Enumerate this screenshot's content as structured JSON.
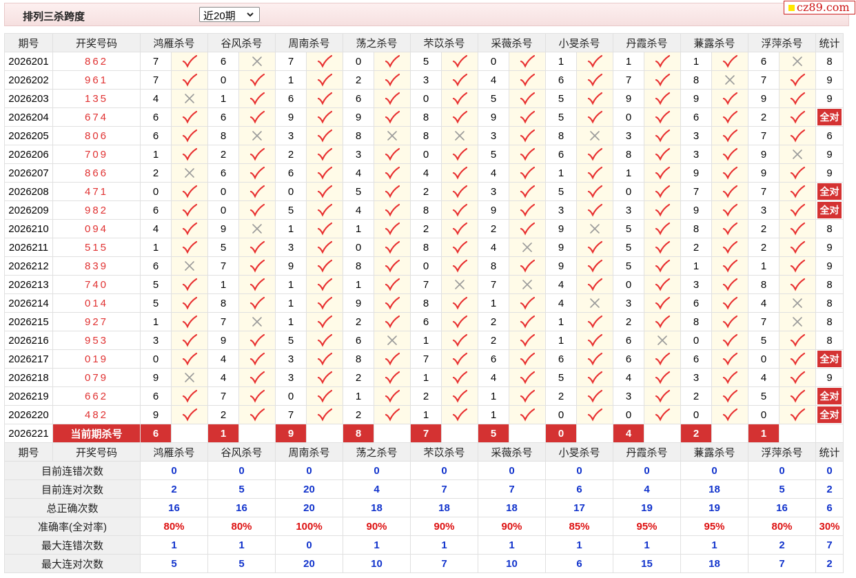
{
  "header": {
    "title": "排列三杀跨度",
    "range_select": "近20期",
    "logo_text": "cz89.com"
  },
  "columns": {
    "period": "期号",
    "draw": "开奖号码",
    "experts": [
      "鸿雁杀号",
      "谷风杀号",
      "周南杀号",
      "荡之杀号",
      "芣苡杀号",
      "采薇杀号",
      "小旻杀号",
      "丹霞杀号",
      "蒹露杀号",
      "浮萍杀号"
    ],
    "stat": "统计"
  },
  "rows": [
    {
      "period": "2026201",
      "draw": "862",
      "picks": [
        "7",
        "6",
        "7",
        "0",
        "5",
        "0",
        "1",
        "1",
        "1",
        "6"
      ],
      "hits": [
        1,
        0,
        1,
        1,
        1,
        1,
        1,
        1,
        1,
        0
      ],
      "stat": "8"
    },
    {
      "period": "2026202",
      "draw": "961",
      "picks": [
        "7",
        "0",
        "1",
        "2",
        "3",
        "4",
        "6",
        "7",
        "8",
        "7"
      ],
      "hits": [
        1,
        1,
        1,
        1,
        1,
        1,
        1,
        1,
        0,
        1
      ],
      "stat": "9"
    },
    {
      "period": "2026203",
      "draw": "135",
      "picks": [
        "4",
        "1",
        "6",
        "6",
        "0",
        "5",
        "5",
        "9",
        "9",
        "9"
      ],
      "hits": [
        0,
        1,
        1,
        1,
        1,
        1,
        1,
        1,
        1,
        1
      ],
      "stat": "9"
    },
    {
      "period": "2026204",
      "draw": "674",
      "picks": [
        "6",
        "6",
        "9",
        "9",
        "8",
        "9",
        "5",
        "0",
        "6",
        "2"
      ],
      "hits": [
        1,
        1,
        1,
        1,
        1,
        1,
        1,
        1,
        1,
        1
      ],
      "stat": "全对"
    },
    {
      "period": "2026205",
      "draw": "806",
      "picks": [
        "6",
        "8",
        "3",
        "8",
        "8",
        "3",
        "8",
        "3",
        "3",
        "7"
      ],
      "hits": [
        1,
        0,
        1,
        0,
        0,
        1,
        0,
        1,
        1,
        1
      ],
      "stat": "6"
    },
    {
      "period": "2026206",
      "draw": "709",
      "picks": [
        "1",
        "2",
        "2",
        "3",
        "0",
        "5",
        "6",
        "8",
        "3",
        "9"
      ],
      "hits": [
        1,
        1,
        1,
        1,
        1,
        1,
        1,
        1,
        1,
        0
      ],
      "stat": "9"
    },
    {
      "period": "2026207",
      "draw": "866",
      "picks": [
        "2",
        "6",
        "6",
        "4",
        "4",
        "4",
        "1",
        "1",
        "9",
        "9"
      ],
      "hits": [
        0,
        1,
        1,
        1,
        1,
        1,
        1,
        1,
        1,
        1
      ],
      "stat": "9"
    },
    {
      "period": "2026208",
      "draw": "471",
      "picks": [
        "0",
        "0",
        "0",
        "5",
        "2",
        "3",
        "5",
        "0",
        "7",
        "7"
      ],
      "hits": [
        1,
        1,
        1,
        1,
        1,
        1,
        1,
        1,
        1,
        1
      ],
      "stat": "全对"
    },
    {
      "period": "2026209",
      "draw": "982",
      "picks": [
        "6",
        "0",
        "5",
        "4",
        "8",
        "9",
        "3",
        "3",
        "9",
        "3"
      ],
      "hits": [
        1,
        1,
        1,
        1,
        1,
        1,
        1,
        1,
        1,
        1
      ],
      "stat": "全对"
    },
    {
      "period": "2026210",
      "draw": "094",
      "picks": [
        "4",
        "9",
        "1",
        "1",
        "2",
        "2",
        "9",
        "5",
        "8",
        "2"
      ],
      "hits": [
        1,
        0,
        1,
        1,
        1,
        1,
        0,
        1,
        1,
        1
      ],
      "stat": "8"
    },
    {
      "period": "2026211",
      "draw": "515",
      "picks": [
        "1",
        "5",
        "3",
        "0",
        "8",
        "4",
        "9",
        "5",
        "2",
        "2"
      ],
      "hits": [
        1,
        1,
        1,
        1,
        1,
        0,
        1,
        1,
        1,
        1
      ],
      "stat": "9"
    },
    {
      "period": "2026212",
      "draw": "839",
      "picks": [
        "6",
        "7",
        "9",
        "8",
        "0",
        "8",
        "9",
        "5",
        "1",
        "1"
      ],
      "hits": [
        0,
        1,
        1,
        1,
        1,
        1,
        1,
        1,
        1,
        1
      ],
      "stat": "9"
    },
    {
      "period": "2026213",
      "draw": "740",
      "picks": [
        "5",
        "1",
        "1",
        "1",
        "7",
        "7",
        "4",
        "0",
        "3",
        "8"
      ],
      "hits": [
        1,
        1,
        1,
        1,
        0,
        0,
        1,
        1,
        1,
        1
      ],
      "stat": "8"
    },
    {
      "period": "2026214",
      "draw": "014",
      "picks": [
        "5",
        "8",
        "1",
        "9",
        "8",
        "1",
        "4",
        "3",
        "6",
        "4"
      ],
      "hits": [
        1,
        1,
        1,
        1,
        1,
        1,
        0,
        1,
        1,
        0
      ],
      "stat": "8"
    },
    {
      "period": "2026215",
      "draw": "927",
      "picks": [
        "1",
        "7",
        "1",
        "2",
        "6",
        "2",
        "1",
        "2",
        "8",
        "7"
      ],
      "hits": [
        1,
        0,
        1,
        1,
        1,
        1,
        1,
        1,
        1,
        0
      ],
      "stat": "8"
    },
    {
      "period": "2026216",
      "draw": "953",
      "picks": [
        "3",
        "9",
        "5",
        "6",
        "1",
        "2",
        "1",
        "6",
        "0",
        "5"
      ],
      "hits": [
        1,
        1,
        1,
        0,
        1,
        1,
        1,
        0,
        1,
        1
      ],
      "stat": "8"
    },
    {
      "period": "2026217",
      "draw": "019",
      "picks": [
        "0",
        "4",
        "3",
        "8",
        "7",
        "6",
        "6",
        "6",
        "6",
        "0"
      ],
      "hits": [
        1,
        1,
        1,
        1,
        1,
        1,
        1,
        1,
        1,
        1
      ],
      "stat": "全对"
    },
    {
      "period": "2026218",
      "draw": "079",
      "picks": [
        "9",
        "4",
        "3",
        "2",
        "1",
        "4",
        "5",
        "4",
        "3",
        "4"
      ],
      "hits": [
        0,
        1,
        1,
        1,
        1,
        1,
        1,
        1,
        1,
        1
      ],
      "stat": "9"
    },
    {
      "period": "2026219",
      "draw": "662",
      "picks": [
        "6",
        "7",
        "0",
        "1",
        "2",
        "1",
        "2",
        "3",
        "2",
        "5"
      ],
      "hits": [
        1,
        1,
        1,
        1,
        1,
        1,
        1,
        1,
        1,
        1
      ],
      "stat": "全对"
    },
    {
      "period": "2026220",
      "draw": "482",
      "picks": [
        "9",
        "2",
        "7",
        "2",
        "1",
        "1",
        "0",
        "0",
        "0",
        "0"
      ],
      "hits": [
        1,
        1,
        1,
        1,
        1,
        1,
        1,
        1,
        1,
        1
      ],
      "stat": "全对"
    }
  ],
  "current": {
    "period": "2026221",
    "label": "当前期杀号",
    "picks": [
      "6",
      "1",
      "9",
      "8",
      "7",
      "5",
      "0",
      "4",
      "2",
      "1"
    ]
  },
  "summary": [
    {
      "label": "目前连错次数",
      "values": [
        "0",
        "0",
        "0",
        "0",
        "0",
        "0",
        "0",
        "0",
        "0",
        "0"
      ],
      "stat": "0",
      "color": "blue"
    },
    {
      "label": "目前连对次数",
      "values": [
        "2",
        "5",
        "20",
        "4",
        "7",
        "7",
        "6",
        "4",
        "18",
        "5"
      ],
      "stat": "2",
      "color": "blue"
    },
    {
      "label": "总正确次数",
      "values": [
        "16",
        "16",
        "20",
        "18",
        "18",
        "18",
        "17",
        "19",
        "19",
        "16"
      ],
      "stat": "6",
      "color": "blue"
    },
    {
      "label": "准确率(全对率)",
      "values": [
        "80%",
        "80%",
        "100%",
        "90%",
        "90%",
        "90%",
        "85%",
        "95%",
        "95%",
        "80%"
      ],
      "stat": "30%",
      "color": "red"
    },
    {
      "label": "最大连错次数",
      "values": [
        "1",
        "1",
        "0",
        "1",
        "1",
        "1",
        "1",
        "1",
        "1",
        "2"
      ],
      "stat": "7",
      "color": "blue"
    },
    {
      "label": "最大连对次数",
      "values": [
        "5",
        "5",
        "20",
        "10",
        "7",
        "10",
        "6",
        "15",
        "18",
        "7"
      ],
      "stat": "2",
      "color": "blue"
    }
  ],
  "icons": {
    "hit": "check-icon",
    "miss": "cross-icon",
    "hit_color": "#e83030",
    "miss_color": "#9a9a9a"
  },
  "colors": {
    "accent": "#d43232",
    "blue": "#1133cc",
    "red": "#dd1111"
  }
}
